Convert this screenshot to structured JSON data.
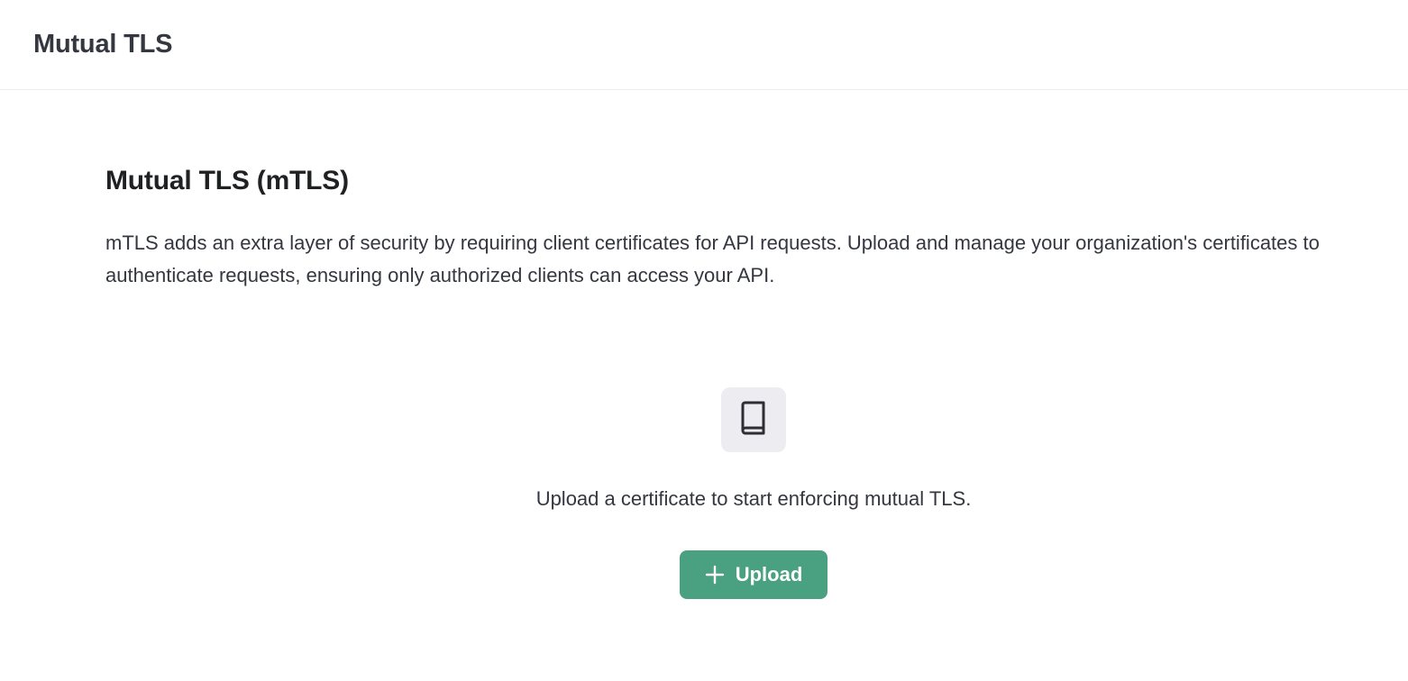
{
  "header": {
    "title": "Mutual TLS"
  },
  "main": {
    "heading": "Mutual TLS (mTLS)",
    "description": "mTLS adds an extra layer of security by requiring client certificates for API requests. Upload and manage your organization's certificates to authenticate requests, ensuring only authorized clients can access your API.",
    "empty_state": {
      "icon": "book-icon",
      "message": "Upload a certificate to start enforcing mutual TLS.",
      "button_label": "Upload",
      "button_icon": "plus-icon"
    }
  },
  "colors": {
    "accent": "#4aa181",
    "icon_box_bg": "#ececf1",
    "text": "#353740"
  }
}
